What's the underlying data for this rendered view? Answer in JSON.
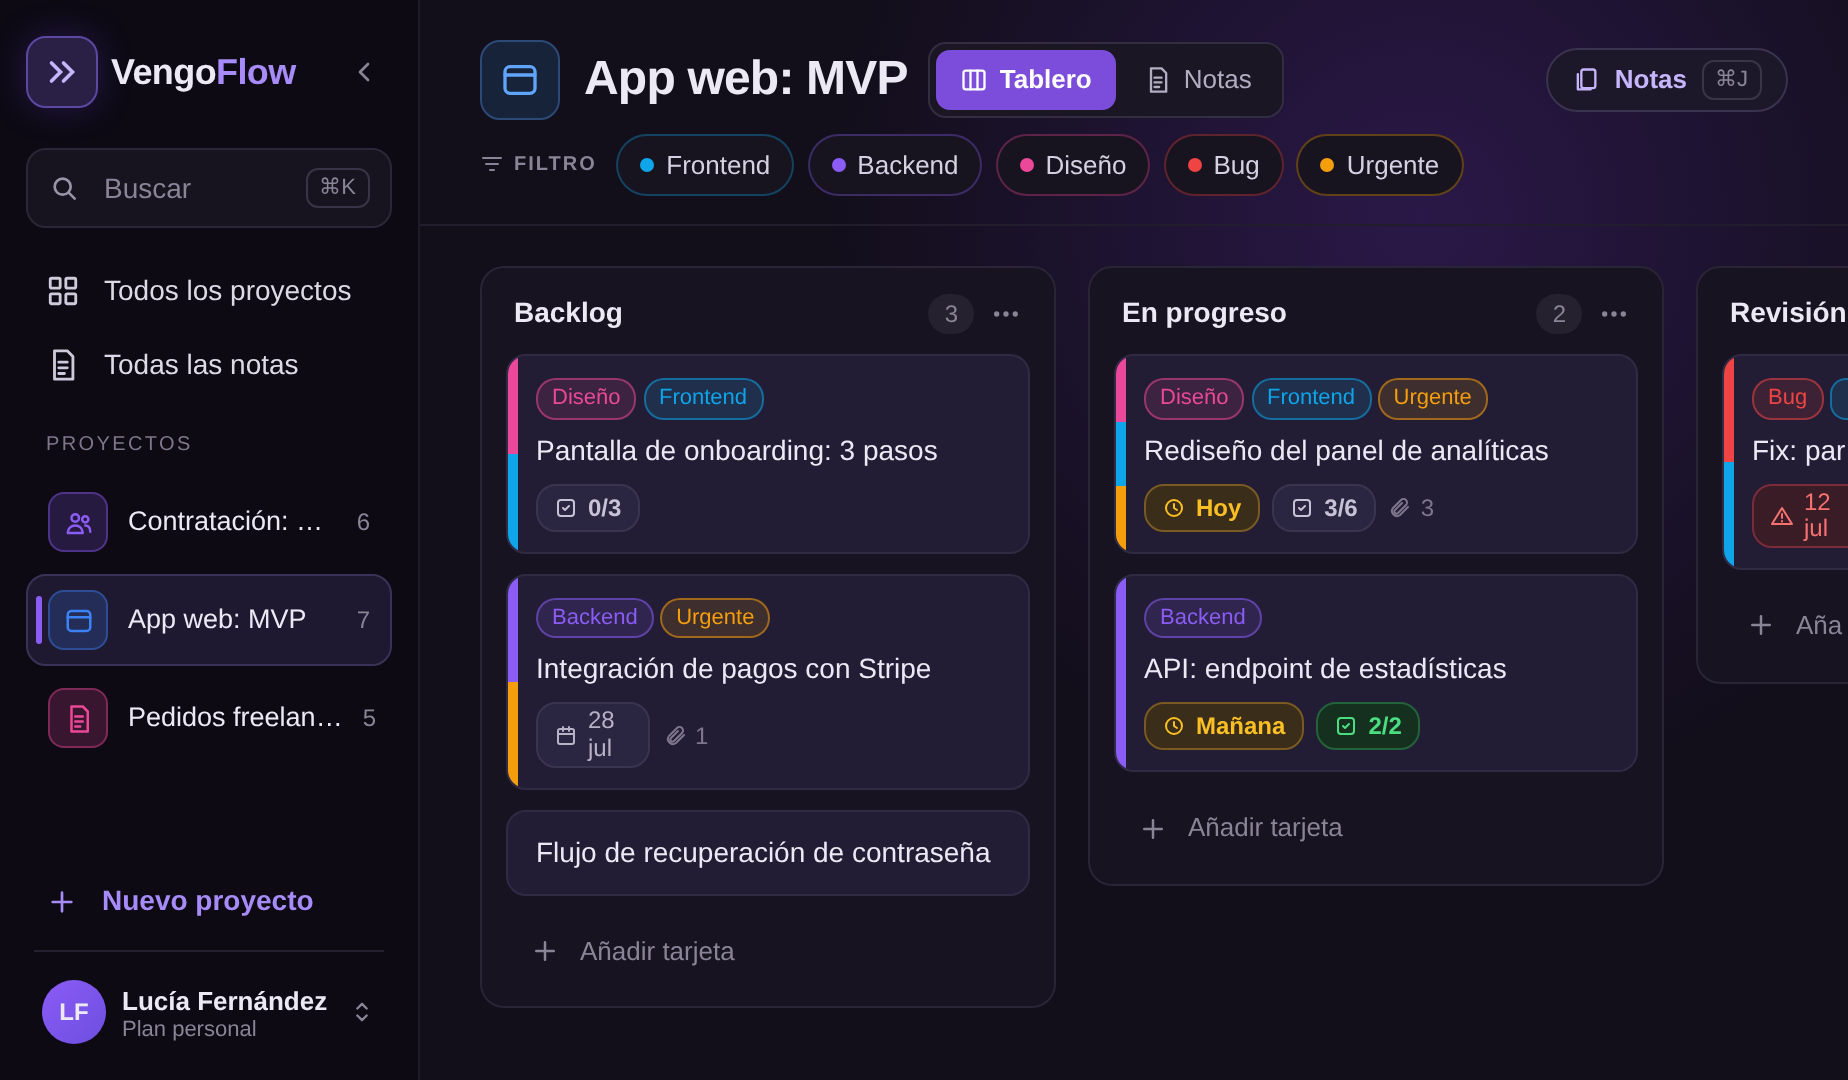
{
  "sidebar": {
    "brand": {
      "first": "Vengo",
      "accent": "Flow"
    },
    "search": {
      "placeholder": "Buscar",
      "shortcut": "⌘K"
    },
    "nav": [
      {
        "kind": "grid",
        "label": "Todos los proyectos"
      },
      {
        "kind": "doc",
        "label": "Todas las notas"
      }
    ],
    "section_label": "PROYECTOS",
    "projects": [
      {
        "kind": "people",
        "color": "#8b5cf6",
        "label": "Contratación: …",
        "count": "6",
        "selected": false
      },
      {
        "kind": "browser",
        "color": "#3b82f6",
        "label": "App web: MVP",
        "count": "7",
        "selected": true
      },
      {
        "kind": "doc",
        "color": "#ec4899",
        "label": "Pedidos freelan…",
        "count": "5",
        "selected": false
      }
    ],
    "new_project": "Nuevo proyecto",
    "user": {
      "initials": "LF",
      "name": "Lucía Fernández",
      "plan": "Plan personal"
    }
  },
  "header": {
    "title": "App web: MVP",
    "views": [
      {
        "kind": "columns",
        "label": "Tablero",
        "selected": true
      },
      {
        "kind": "doc",
        "label": "Notas",
        "selected": false
      }
    ],
    "notes_button": {
      "label": "Notas",
      "shortcut": "⌘J"
    },
    "filter_label": "FILTRO",
    "filters": [
      {
        "label": "Frontend",
        "color": "#0ea5e9"
      },
      {
        "label": "Backend",
        "color": "#8b5cf6"
      },
      {
        "label": "Diseño",
        "color": "#ec4899"
      },
      {
        "label": "Bug",
        "color": "#ef4444"
      },
      {
        "label": "Urgente",
        "color": "#f59e0b"
      }
    ]
  },
  "columns": [
    {
      "title": "Backlog",
      "count": "3",
      "cards": [
        {
          "tags": [
            {
              "label": "Diseño",
              "color": "#ec4899"
            },
            {
              "label": "Frontend",
              "color": "#0ea5e9"
            }
          ],
          "title": "Pantalla de onboarding: 3 pasos",
          "meta": [
            {
              "kind": "checklist",
              "text": "0/3",
              "complete": false
            }
          ]
        },
        {
          "tags": [
            {
              "label": "Backend",
              "color": "#8b5cf6"
            },
            {
              "label": "Urgente",
              "color": "#f59e0b"
            }
          ],
          "title": "Integración de pagos con Stripe",
          "meta": [
            {
              "kind": "date",
              "text": "28 jul"
            },
            {
              "kind": "attachments",
              "text": "1"
            }
          ]
        },
        {
          "title": "Flujo de recuperación de contraseña"
        }
      ],
      "add_label": "Añadir tarjeta"
    },
    {
      "title": "En progreso",
      "count": "2",
      "cards": [
        {
          "tags": [
            {
              "label": "Diseño",
              "color": "#ec4899"
            },
            {
              "label": "Frontend",
              "color": "#0ea5e9"
            },
            {
              "label": "Urgente",
              "color": "#f59e0b"
            }
          ],
          "title": "Rediseño del panel de analíticas",
          "meta": [
            {
              "kind": "due",
              "text": "Hoy"
            },
            {
              "kind": "checklist",
              "text": "3/6",
              "complete": false
            },
            {
              "kind": "attachments",
              "text": "3"
            }
          ]
        },
        {
          "tags": [
            {
              "label": "Backend",
              "color": "#8b5cf6"
            }
          ],
          "title": "API: endpoint de estadísticas",
          "meta": [
            {
              "kind": "due",
              "text": "Mañana"
            },
            {
              "kind": "checklist",
              "text": "2/2",
              "complete": true
            }
          ]
        }
      ],
      "add_label": "Añadir tarjeta"
    },
    {
      "title": "Revisión",
      "cards": [
        {
          "tags": [
            {
              "label": "Bug",
              "color": "#ef4444"
            },
            {
              "color": "#0ea5e9"
            }
          ],
          "title": "Fix: par",
          "meta": [
            {
              "kind": "overdue",
              "text": "12 jul"
            }
          ]
        }
      ],
      "add_label": "Aña"
    }
  ]
}
